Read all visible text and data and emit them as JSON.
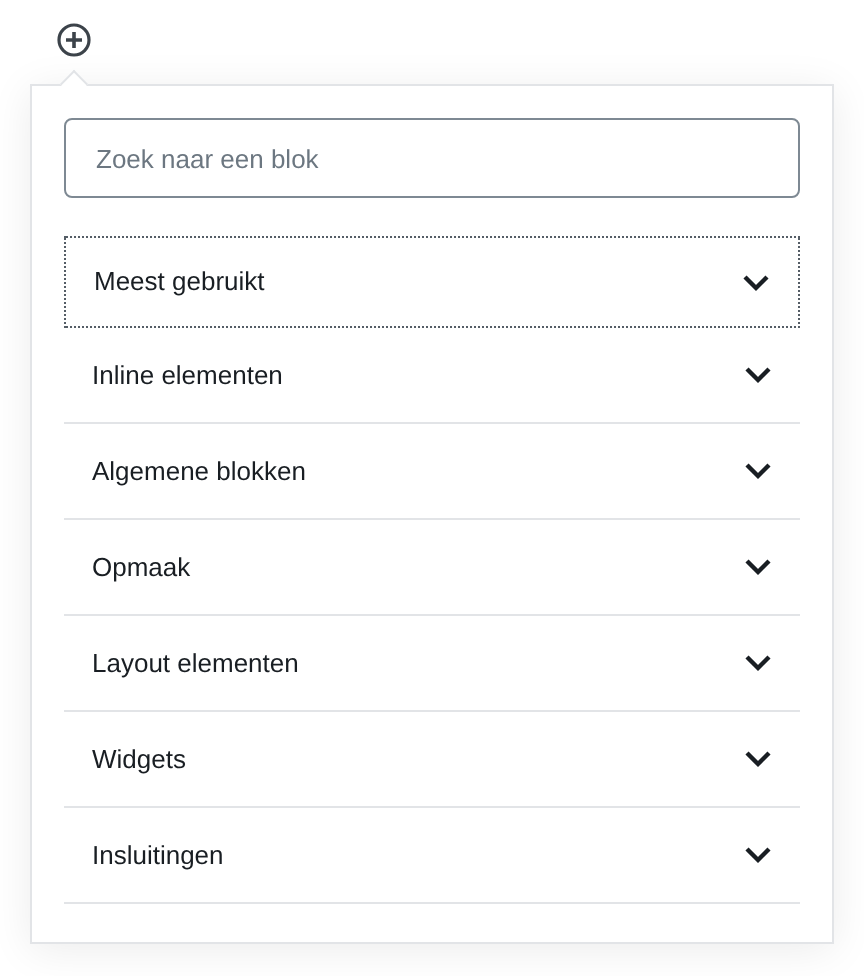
{
  "search": {
    "placeholder": "Zoek naar een blok"
  },
  "panels": [
    {
      "title": "Meest gebruikt",
      "focused": true,
      "expanded": false
    },
    {
      "title": "Inline elementen",
      "focused": false,
      "expanded": false
    },
    {
      "title": "Algemene blokken",
      "focused": false,
      "expanded": false
    },
    {
      "title": "Opmaak",
      "focused": false,
      "expanded": false
    },
    {
      "title": "Layout elementen",
      "focused": false,
      "expanded": false
    },
    {
      "title": "Widgets",
      "focused": false,
      "expanded": false
    },
    {
      "title": "Insluitingen",
      "focused": false,
      "expanded": false
    }
  ]
}
